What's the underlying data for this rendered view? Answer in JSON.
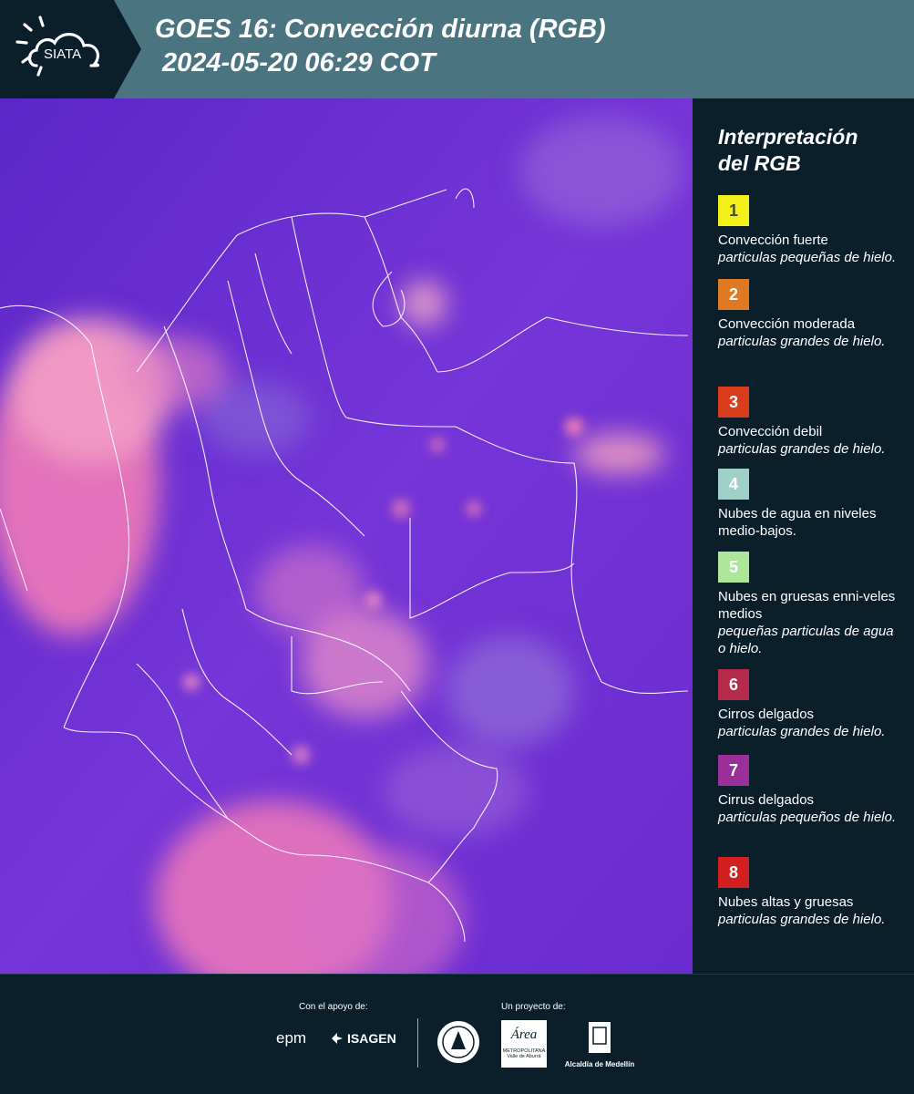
{
  "header": {
    "logo_text": "SIATA",
    "title_line1": "GOES 16: Convección diurna (RGB)",
    "title_line2": "2024-05-20 06:29 COT"
  },
  "legend": {
    "title_line1": "Interpretación",
    "title_line2": "del RGB",
    "items": [
      {
        "number": "1",
        "color": "#f2f21a",
        "num_color": "#4a4a2a",
        "name": "Convección fuerte",
        "desc": "particulas pequeñas de hielo."
      },
      {
        "number": "2",
        "color": "#e07a22",
        "num_color": "#ffffff",
        "name": "Convección moderada",
        "desc": "particulas grandes de hielo."
      },
      {
        "number": "3",
        "color": "#d83c1a",
        "num_color": "#ffffff",
        "name": "Convección debil",
        "desc": "particulas grandes de hielo."
      },
      {
        "number": "4",
        "color": "#9fd0c8",
        "num_color": "#ffffff",
        "name": "Nubes de agua en niveles medio-bajos.",
        "desc": ""
      },
      {
        "number": "5",
        "color": "#aee79a",
        "num_color": "#ffffff",
        "name": "Nubes en gruesas enni-veles medios",
        "desc": "pequeñas particulas de agua o hielo."
      },
      {
        "number": "6",
        "color": "#b52a4a",
        "num_color": "#ffffff",
        "name": "Cirros delgados",
        "desc": "particulas grandes de hielo."
      },
      {
        "number": "7",
        "color": "#9a2f9a",
        "num_color": "#ffffff",
        "name": "Cirrus delgados",
        "desc": "particulas pequeños de hielo."
      },
      {
        "number": "8",
        "color": "#d21f1f",
        "num_color": "#ffffff",
        "name": "Nubes altas y gruesas",
        "desc": "particulas grandes de hielo."
      }
    ]
  },
  "footer": {
    "support_label": "Con el apoyo de:",
    "project_label": "Un proyecto de:",
    "sponsor1": "epm",
    "sponsor2": "ISAGEN",
    "partner_area_line1": "METROPOLITANA",
    "partner_area_line2": "Valle de Aburrá",
    "partner_area_logo": "Área",
    "partner_alcaldia": "Alcaldía de Medellín"
  },
  "colors": {
    "header_bg": "#4a7480",
    "page_bg": "#0b1f2b",
    "map_base": "#6a2fd3"
  }
}
